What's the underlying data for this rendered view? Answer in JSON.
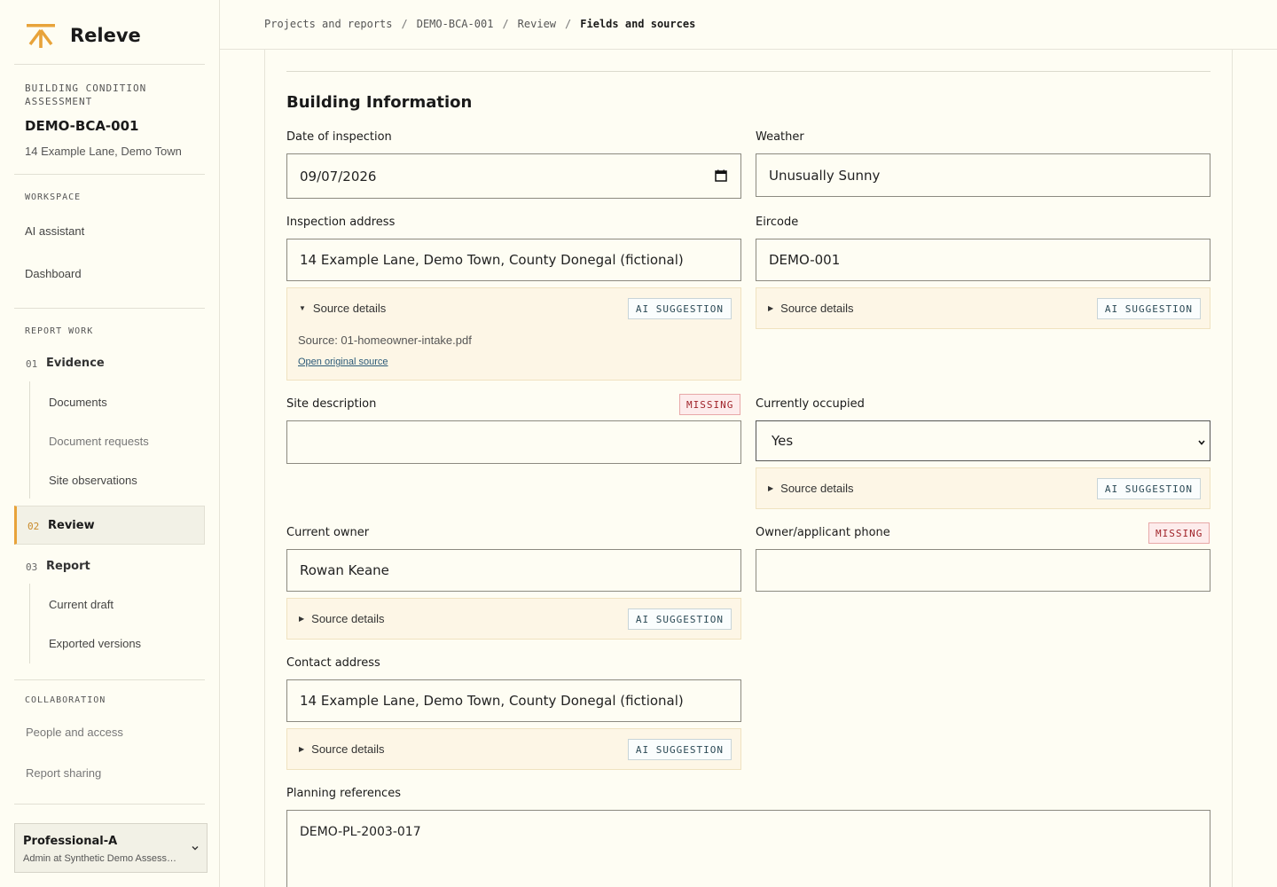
{
  "app": {
    "name": "Releve",
    "brand_color": "#e8a33a"
  },
  "project": {
    "kind": "BUILDING CONDITION ASSESSMENT",
    "id": "DEMO-BCA-001",
    "address": "14 Example Lane, Demo Town"
  },
  "sidebar": {
    "workspace_title": "WORKSPACE",
    "workspace_items": [
      "AI assistant",
      "Dashboard"
    ],
    "report_work_title": "REPORT WORK",
    "evidence": {
      "num": "01",
      "label": "Evidence",
      "children": [
        "Documents",
        "Document requests",
        "Site observations"
      ]
    },
    "review": {
      "num": "02",
      "label": "Review"
    },
    "report": {
      "num": "03",
      "label": "Report",
      "children": [
        "Current draft",
        "Exported versions"
      ]
    },
    "collab_title": "COLLABORATION",
    "collab_items": [
      "People and access",
      "Report sharing"
    ]
  },
  "user": {
    "name": "Professional-A",
    "role": "Admin at Synthetic Demo Assessments"
  },
  "breadcrumb": [
    "Projects and reports",
    "DEMO-BCA-001",
    "Review",
    "Fields and sources"
  ],
  "section_title": "Building Information",
  "fields": {
    "date_label": "Date of inspection",
    "date_value": "09/07/2026",
    "weather_label": "Weather",
    "weather_value": "Unusually Sunny",
    "insp_addr_label": "Inspection address",
    "insp_addr_value": "14 Example Lane, Demo Town, County Donegal (fictional)",
    "eircode_label": "Eircode",
    "eircode_value": "DEMO-001",
    "site_desc_label": "Site description",
    "site_desc_value": "",
    "occupied_label": "Currently occupied",
    "occupied_value": "Yes",
    "owner_label": "Current owner",
    "owner_value": "Rowan Keane",
    "phone_label": "Owner/applicant phone",
    "phone_value": "",
    "contact_label": "Contact address",
    "contact_value": "14 Example Lane, Demo Town, County Donegal (fictional)",
    "planning_label": "Planning references",
    "planning_value": "DEMO-PL-2003-017"
  },
  "source": {
    "toggle": "Source details",
    "ai_badge": "AI SUGGESTION",
    "missing_badge": "MISSING",
    "expanded_source": "Source: 01-homeowner-intake.pdf",
    "open_link": "Open original source"
  }
}
